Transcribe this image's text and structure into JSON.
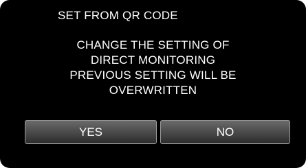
{
  "dialog": {
    "title": "SET FROM QR CODE",
    "message_lines": [
      "CHANGE THE SETTING OF",
      "DIRECT MONITORING",
      "PREVIOUS SETTING WILL BE",
      "OVERWRITTEN"
    ],
    "buttons": {
      "yes_label": "YES",
      "no_label": "NO"
    }
  }
}
